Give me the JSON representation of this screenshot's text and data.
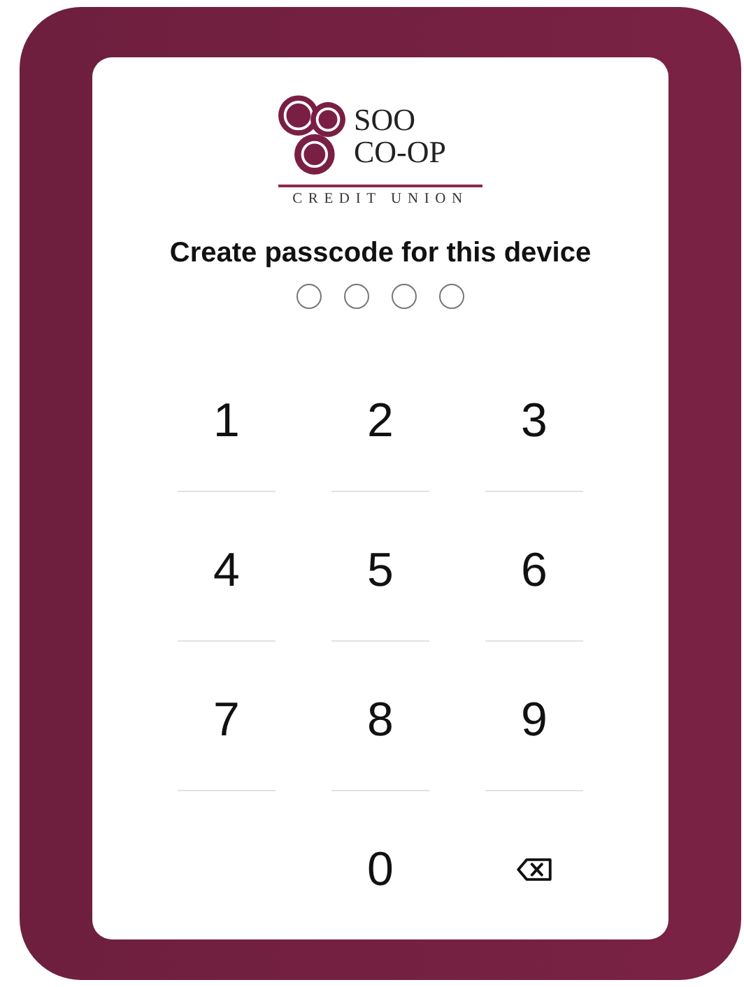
{
  "logo": {
    "lines": [
      "SOO",
      "CO-OP"
    ],
    "tagline": "CREDIT UNION"
  },
  "title": "Create passcode for this device",
  "passcode_dots": [
    {
      "filled": false
    },
    {
      "filled": false
    },
    {
      "filled": false
    },
    {
      "filled": false
    }
  ],
  "keys": [
    {
      "kind": "digit",
      "label": "1"
    },
    {
      "kind": "digit",
      "label": "2"
    },
    {
      "kind": "digit",
      "label": "3"
    },
    {
      "kind": "digit",
      "label": "4"
    },
    {
      "kind": "digit",
      "label": "5"
    },
    {
      "kind": "digit",
      "label": "6"
    },
    {
      "kind": "digit",
      "label": "7"
    },
    {
      "kind": "digit",
      "label": "8"
    },
    {
      "kind": "digit",
      "label": "9"
    },
    {
      "kind": "blank"
    },
    {
      "kind": "digit",
      "label": "0"
    },
    {
      "kind": "backspace"
    }
  ]
}
